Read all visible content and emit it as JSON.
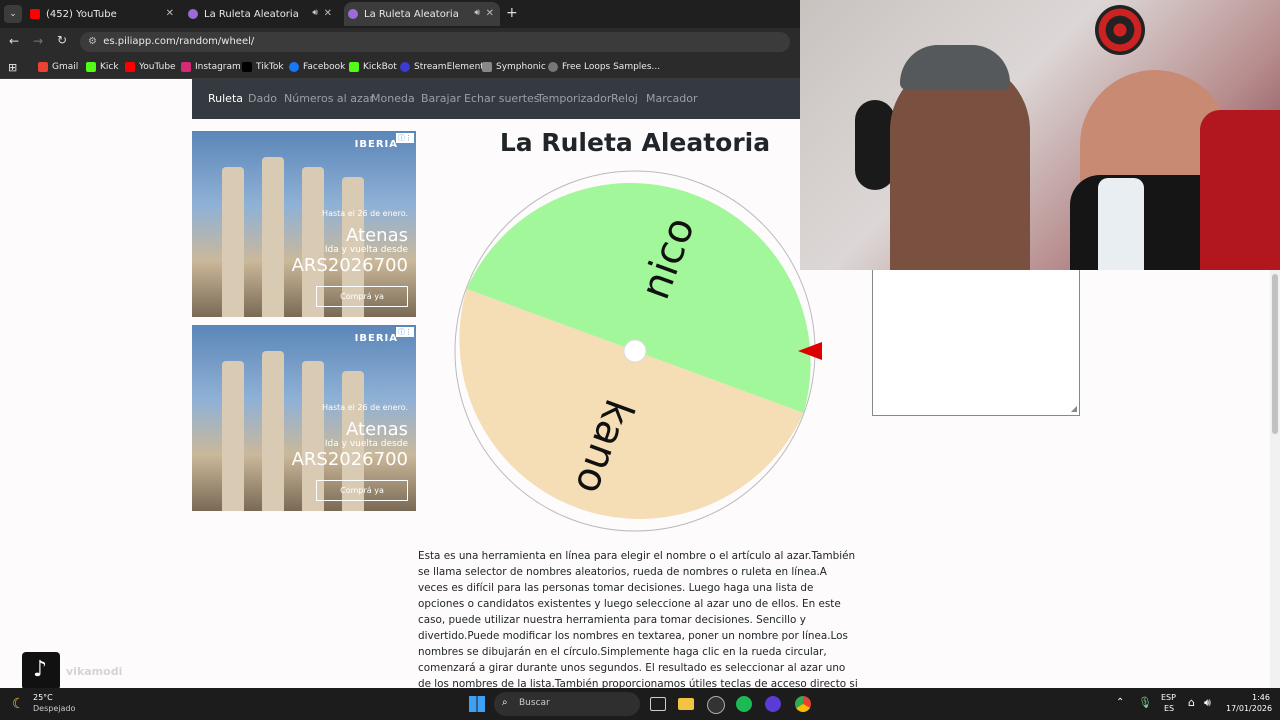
{
  "browser": {
    "tabs": [
      {
        "label": "(452) YouTube",
        "color": "#ff0000"
      },
      {
        "label": "La Ruleta Aleatoria",
        "color": "#9c6bd6"
      },
      {
        "label": "La Ruleta Aleatoria",
        "color": "#9c6bd6"
      }
    ],
    "new_tab": "+",
    "url": "es.piliapp.com/random/wheel/",
    "bookmarks": [
      {
        "label": "Gmail",
        "color": "#ea4335"
      },
      {
        "label": "Kick",
        "color": "#53fc18"
      },
      {
        "label": "YouTube",
        "color": "#ff0000"
      },
      {
        "label": "Instagram",
        "color": "#d62976"
      },
      {
        "label": "TikTok",
        "color": "#000000"
      },
      {
        "label": "Facebook",
        "color": "#1877f2"
      },
      {
        "label": "KickBot",
        "color": "#53fc18"
      },
      {
        "label": "StreamElements",
        "color": "#3b3bcf"
      },
      {
        "label": "Symphonic",
        "color": "#888888"
      },
      {
        "label": "Free Loops Samples...",
        "color": "#777777"
      }
    ]
  },
  "site_nav": [
    "Ruleta",
    "Dado",
    "Números al azar",
    "Moneda",
    "Barajar",
    "Echar suertes",
    "Temporizador",
    "Reloj",
    "Marcador"
  ],
  "ads": [
    {
      "brand": "IBERIA",
      "l1": "Hasta el 26 de enero.",
      "l2": "Atenas",
      "l3": "Ida y vuelta desde",
      "l4": "ARS2026700",
      "cta": "Comprá ya"
    },
    {
      "brand": "IBERIA",
      "l1": "Hasta el 26 de enero.",
      "l2": "Atenas",
      "l3": "Ida y vuelta desde",
      "l4": "ARS2026700",
      "cta": "Comprá ya"
    }
  ],
  "page_title": "La Ruleta Aleatoria",
  "wheel": {
    "segments": [
      {
        "name": "nico",
        "color": "#a2f79a"
      },
      {
        "name": "kano",
        "color": "#f5deb5"
      }
    ],
    "pointer_color": "#dd0000"
  },
  "description": "Esta es una herramienta en línea para elegir el nombre o el artículo al azar.También se llama selector de nombres aleatorios, rueda de nombres o ruleta en línea.A veces es difícil para las personas tomar decisiones. Luego haga una lista de opciones o candidatos existentes y luego seleccione al azar uno de ellos. En este caso, puede utilizar nuestra herramienta para tomar decisiones. Sencillo y divertido.Puede modificar los nombres en textarea, poner un nombre por línea.Los nombres se dibujarán en el círculo.Simplemente haga clic en la rueda circular, comenzará a girar durante unos segundos. El resultado es seleccionar al azar uno de los nombres de la lista.También proporcionamos útiles teclas de acceso directo si está utilizando el escritorio.",
  "overlay": {
    "tiktok_handle": "vikamodi"
  },
  "taskbar": {
    "weather_temp": "25°C",
    "weather_desc": "Despejado",
    "search_label": "Buscar",
    "lang1": "ESP",
    "lang2": "ES",
    "time": "1:46",
    "date": "17/01/2026"
  }
}
